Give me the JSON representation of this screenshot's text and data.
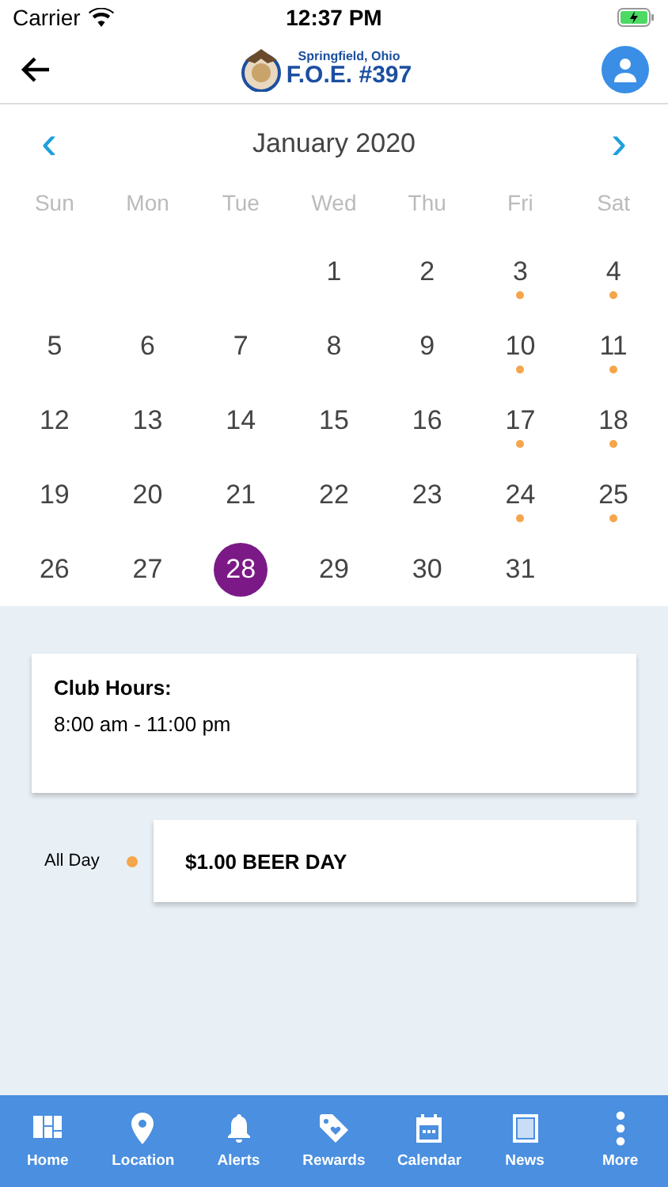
{
  "status_bar": {
    "carrier": "Carrier",
    "time": "12:37 PM"
  },
  "header": {
    "logo_subtitle": "Springfield, Ohio",
    "logo_title": "F.O.E. #397"
  },
  "calendar": {
    "month": "January 2020",
    "prev": "‹",
    "next": "›",
    "weekdays": [
      "Sun",
      "Mon",
      "Tue",
      "Wed",
      "Thu",
      "Fri",
      "Sat"
    ],
    "cells": [
      {
        "kind": "blank"
      },
      {
        "kind": "blank"
      },
      {
        "kind": "blank"
      },
      {
        "kind": "day",
        "day": "1",
        "selected": false,
        "has_event": false
      },
      {
        "kind": "day",
        "day": "2",
        "selected": false,
        "has_event": false
      },
      {
        "kind": "day",
        "day": "3",
        "selected": false,
        "has_event": true
      },
      {
        "kind": "day",
        "day": "4",
        "selected": false,
        "has_event": true
      },
      {
        "kind": "day",
        "day": "5",
        "selected": false,
        "has_event": false
      },
      {
        "kind": "day",
        "day": "6",
        "selected": false,
        "has_event": false
      },
      {
        "kind": "day",
        "day": "7",
        "selected": false,
        "has_event": false
      },
      {
        "kind": "day",
        "day": "8",
        "selected": false,
        "has_event": false
      },
      {
        "kind": "day",
        "day": "9",
        "selected": false,
        "has_event": false
      },
      {
        "kind": "day",
        "day": "10",
        "selected": false,
        "has_event": true
      },
      {
        "kind": "day",
        "day": "11",
        "selected": false,
        "has_event": true
      },
      {
        "kind": "day",
        "day": "12",
        "selected": false,
        "has_event": false
      },
      {
        "kind": "day",
        "day": "13",
        "selected": false,
        "has_event": false
      },
      {
        "kind": "day",
        "day": "14",
        "selected": false,
        "has_event": false
      },
      {
        "kind": "day",
        "day": "15",
        "selected": false,
        "has_event": false
      },
      {
        "kind": "day",
        "day": "16",
        "selected": false,
        "has_event": false
      },
      {
        "kind": "day",
        "day": "17",
        "selected": false,
        "has_event": true
      },
      {
        "kind": "day",
        "day": "18",
        "selected": false,
        "has_event": true
      },
      {
        "kind": "day",
        "day": "19",
        "selected": false,
        "has_event": false
      },
      {
        "kind": "day",
        "day": "20",
        "selected": false,
        "has_event": false
      },
      {
        "kind": "day",
        "day": "21",
        "selected": false,
        "has_event": false
      },
      {
        "kind": "day",
        "day": "22",
        "selected": false,
        "has_event": false
      },
      {
        "kind": "day",
        "day": "23",
        "selected": false,
        "has_event": false
      },
      {
        "kind": "day",
        "day": "24",
        "selected": false,
        "has_event": true
      },
      {
        "kind": "day",
        "day": "25",
        "selected": false,
        "has_event": true
      },
      {
        "kind": "day",
        "day": "26",
        "selected": false,
        "has_event": false
      },
      {
        "kind": "day",
        "day": "27",
        "selected": false,
        "has_event": false
      },
      {
        "kind": "day",
        "day": "28",
        "selected": true,
        "has_event": false
      },
      {
        "kind": "day",
        "day": "29",
        "selected": false,
        "has_event": false
      },
      {
        "kind": "day",
        "day": "30",
        "selected": false,
        "has_event": false
      },
      {
        "kind": "day",
        "day": "31",
        "selected": false,
        "has_event": false
      },
      {
        "kind": "blank"
      }
    ]
  },
  "hours": {
    "title": "Club Hours:",
    "text": "8:00 am - 11:00 pm"
  },
  "events": [
    {
      "time": "All Day",
      "color": "#f5a54a",
      "title": "$1.00 BEER DAY"
    }
  ],
  "tabs": [
    {
      "label": "Home"
    },
    {
      "label": "Location"
    },
    {
      "label": "Alerts"
    },
    {
      "label": "Rewards"
    },
    {
      "label": "Calendar"
    },
    {
      "label": "News"
    },
    {
      "label": "More"
    }
  ]
}
